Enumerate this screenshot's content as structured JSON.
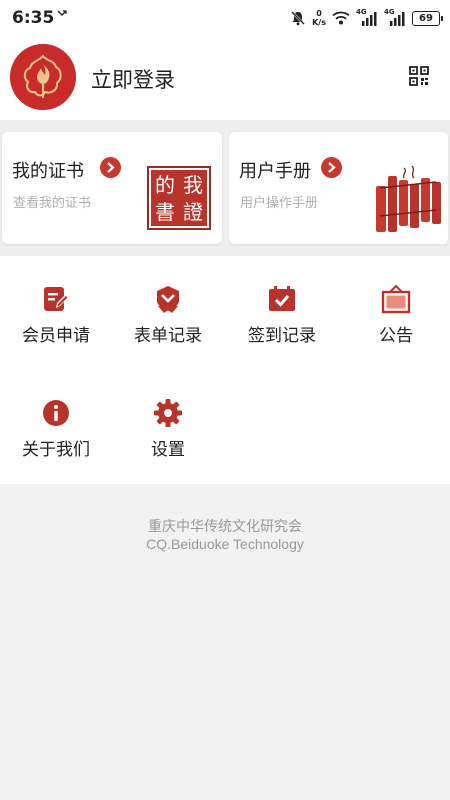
{
  "status_bar": {
    "time": "6:35",
    "net_speed_value": "0",
    "net_speed_unit": "K/s",
    "sim1_label": "4G",
    "sim2_label": "4G",
    "battery": "69"
  },
  "header": {
    "login_label": "立即登录"
  },
  "cards": {
    "certificate": {
      "title": "我的证书",
      "subtitle": "查看我的证书",
      "seal_text": [
        "我",
        "的",
        "證",
        "書"
      ]
    },
    "manual": {
      "title": "用户手册",
      "subtitle": "用户操作手册"
    }
  },
  "menu": {
    "items": [
      {
        "label": "会员申请",
        "icon": "edit-document-icon"
      },
      {
        "label": "表单记录",
        "icon": "ribbon-badge-icon"
      },
      {
        "label": "签到记录",
        "icon": "calendar-check-icon"
      },
      {
        "label": "公告",
        "icon": "notice-board-icon"
      },
      {
        "label": "关于我们",
        "icon": "info-icon"
      },
      {
        "label": "设置",
        "icon": "gear-icon"
      }
    ]
  },
  "footer": {
    "org_name": "重庆中华传统文化研究会",
    "company": "CQ.Beiduoke Technology"
  },
  "colors": {
    "accent": "#c7392f",
    "background": "#f2f2f2",
    "text_muted": "#999999"
  }
}
